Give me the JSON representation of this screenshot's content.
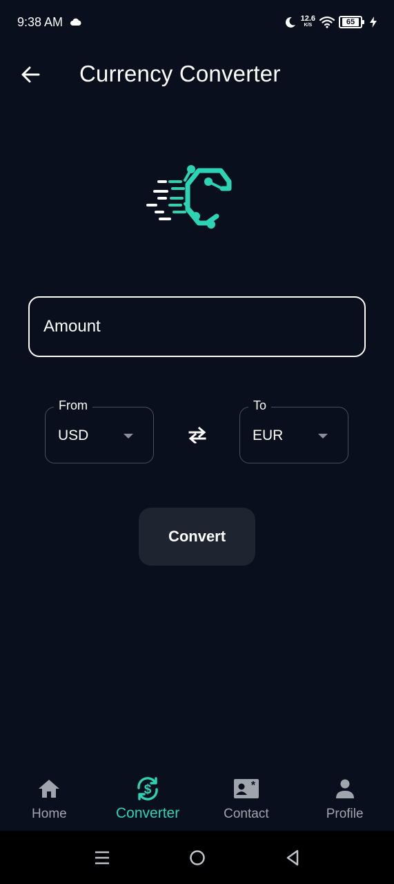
{
  "status_bar": {
    "time": "9:38 AM",
    "speed_value": "12.6",
    "speed_unit": "K/S",
    "battery": "65"
  },
  "header": {
    "title": "Currency Converter"
  },
  "form": {
    "amount_placeholder": "Amount",
    "from_label": "From",
    "from_value": "USD",
    "to_label": "To",
    "to_value": "EUR",
    "convert_label": "Convert"
  },
  "bottom_nav": {
    "items": [
      {
        "label": "Home",
        "icon": "home-icon"
      },
      {
        "label": "Converter",
        "icon": "currency-exchange-icon",
        "active": true
      },
      {
        "label": "Contact",
        "icon": "contact-card-icon"
      },
      {
        "label": "Profile",
        "icon": "person-icon"
      }
    ]
  },
  "colors": {
    "background": "#0a0f1e",
    "accent": "#2dd4b4",
    "button_bg": "#1e2430",
    "inactive": "#a0a4ad"
  }
}
